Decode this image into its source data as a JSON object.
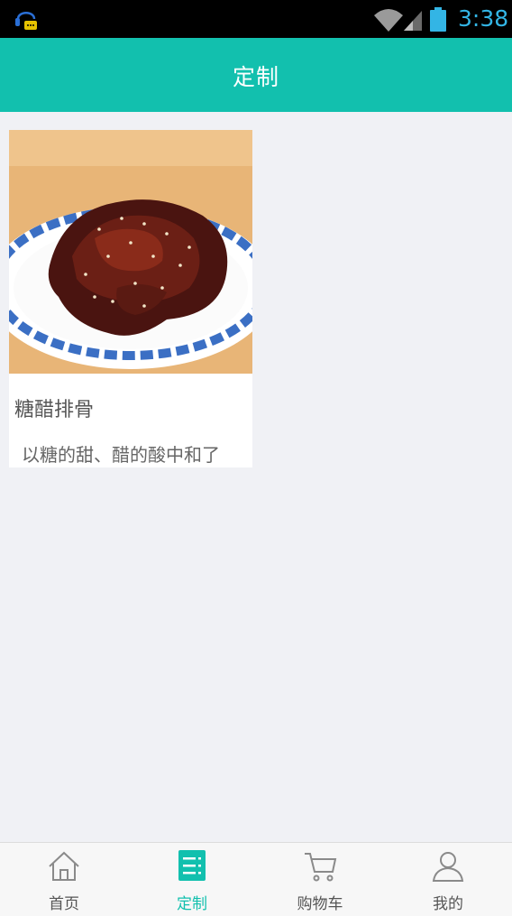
{
  "status_bar": {
    "time": "3:38",
    "icons": [
      "notification-app-icon",
      "wifi-icon",
      "signal-icon",
      "battery-icon"
    ],
    "color": "#33b5e5"
  },
  "header": {
    "title": "定制",
    "background": "#12c0ae"
  },
  "products": [
    {
      "name": "糖醋排骨",
      "description": "以糖的甜、醋的酸中和了",
      "image": "sweet-and-sour-ribs-photo"
    }
  ],
  "bottom_nav": {
    "items": [
      {
        "label": "首页",
        "icon": "home-icon",
        "active": false
      },
      {
        "label": "定制",
        "icon": "list-icon",
        "active": true
      },
      {
        "label": "购物车",
        "icon": "cart-icon",
        "active": false
      },
      {
        "label": "我的",
        "icon": "user-icon",
        "active": false
      }
    ],
    "active_color": "#12c0ae"
  }
}
